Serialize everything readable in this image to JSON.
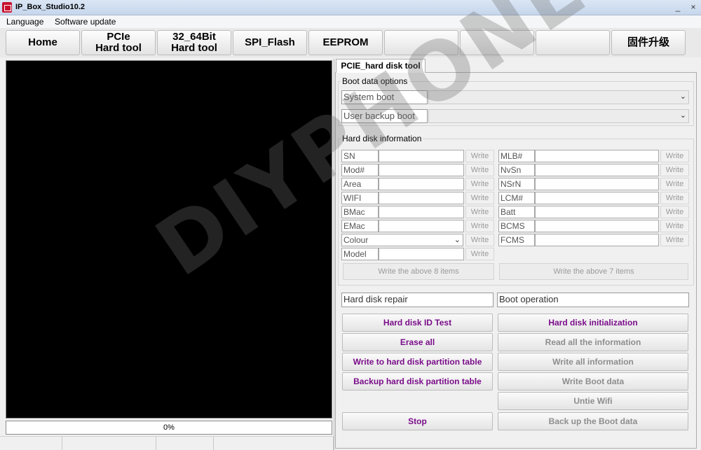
{
  "window": {
    "title": "IP_Box_Studio10.2",
    "minimize": "_",
    "close": "×"
  },
  "menu": {
    "items": [
      "Language",
      "Software update"
    ]
  },
  "modules": {
    "home": "Home",
    "pcie_line1": "PCIe",
    "pcie_line2": "Hard tool",
    "bit_line1": "32_64Bit",
    "bit_line2": "Hard tool",
    "spi": "SPI_Flash",
    "eeprom": "EEPROM",
    "firmware": "固件升级"
  },
  "progress": {
    "text": "0%",
    "value_percent": 0
  },
  "tab": {
    "label": "PCIE_hard disk tool"
  },
  "boot_options": {
    "title": "Boot data options",
    "system_boot": "System boot",
    "user_backup_boot": "User backup boot"
  },
  "hd_info": {
    "title": "Hard disk information",
    "write_label": "Write",
    "left": [
      "SN",
      "Mod#",
      "Area",
      "WIFI",
      "BMac",
      "EMac",
      "Colour",
      "Model"
    ],
    "right": [
      "MLB#",
      "NvSn",
      "NSrN",
      "LCM#",
      "Batt",
      "BCMS",
      "FCMS"
    ],
    "write_left_all": "Write the above 8 items",
    "write_right_all": "Write the above 7 items"
  },
  "repair": {
    "title": "Hard disk repair",
    "buttons": [
      "Hard disk ID Test",
      "Erase all",
      "Write to hard disk partition table",
      "Backup hard disk partition table"
    ],
    "stop": "Stop"
  },
  "boot_op": {
    "title": "Boot operation",
    "buttons": [
      "Hard disk initialization",
      "Read all the information",
      "Write all information",
      "Write Boot data",
      "Untie Wifi",
      "Back up the Boot data"
    ]
  },
  "watermark": "DIYPHONE"
}
